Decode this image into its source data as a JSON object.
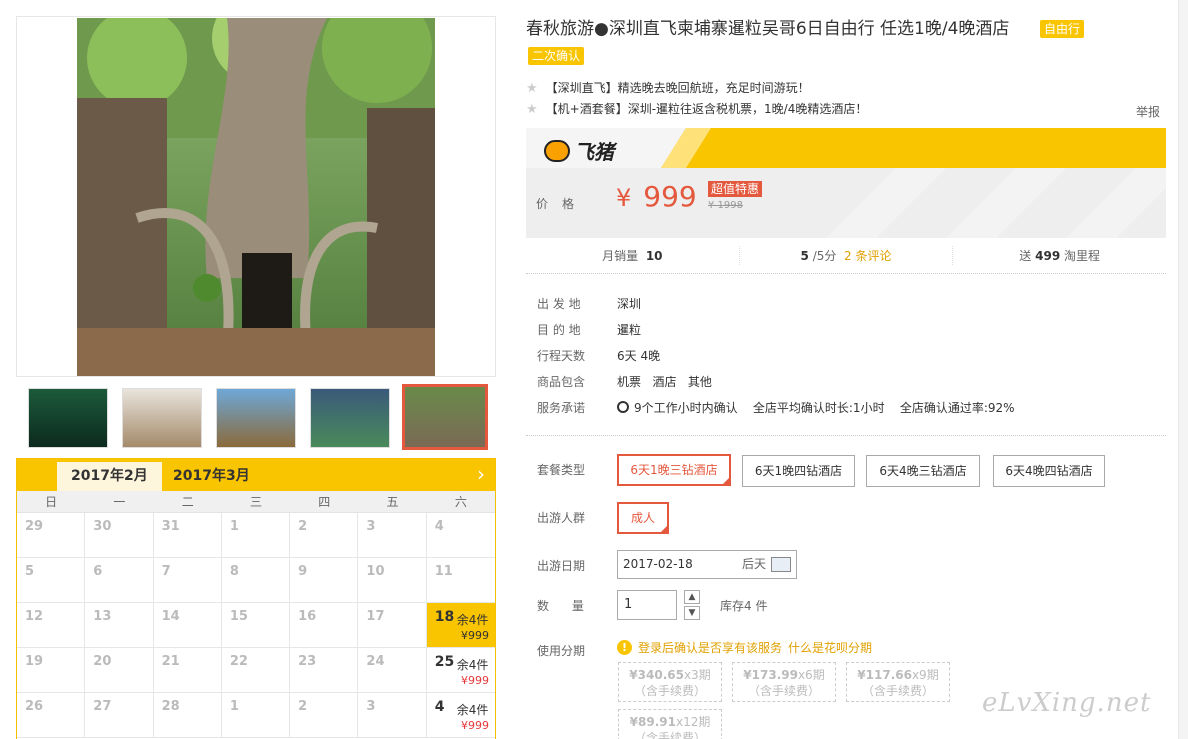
{
  "product": {
    "title": "春秋旅游●深圳直飞柬埔寨暹粒吴哥6日自由行 任选1晚/4晚酒店",
    "tags": [
      "自由行",
      "二次确认"
    ],
    "features": [
      "【深圳直飞】精选晚去晚回航班，充足时间游玩！",
      "【机+酒套餐】深圳-暹粒往返含税机票，1晚/4晚精选酒店！"
    ],
    "report_label": "举报"
  },
  "brand": {
    "name": "飞猪",
    "colors": {
      "accent": "#f9c400",
      "price": "#e4583e"
    }
  },
  "price": {
    "label": "价格",
    "currency": "¥",
    "value": "999",
    "badge": "超值特惠",
    "original": "¥ 1998"
  },
  "stats": {
    "monthly_sales_label": "月销量",
    "monthly_sales": "10",
    "rating": "5",
    "rating_suffix": "/5分",
    "reviews": "2 条评论",
    "mileage_prefix": "送",
    "mileage": "499",
    "mileage_suffix": "淘里程"
  },
  "info": [
    {
      "key": "出 发 地",
      "value": "深圳"
    },
    {
      "key": "目 的 地",
      "value": "暹粒"
    },
    {
      "key": "行程天数",
      "value": "6天 4晚"
    },
    {
      "key": "商品包含",
      "value": "机票   酒店   其他"
    },
    {
      "key": "服务承诺",
      "value": "9个工作小时内确认    全店平均确认时长:1小时    全店确认通过率:92%"
    }
  ],
  "options": {
    "package_label": "套餐类型",
    "packages": [
      "6天1晚三钻酒店",
      "6天1晚四钻酒店",
      "6天4晚三钻酒店",
      "6天4晚四钻酒店"
    ],
    "crowd_label": "出游人群",
    "crowd": "成人",
    "date_label": "出游日期",
    "date_value": "2017-02-18",
    "date_hint": "后天",
    "qty_label": "数      量",
    "qty_value": "1",
    "stock": "库存4 件",
    "installment_label": "使用分期",
    "installment_warn": "登录后确认是否享有该服务",
    "installment_link": "什么是花呗分期",
    "installments": [
      {
        "amount": "¥340.65",
        "period": "x3期",
        "note": "（含手续费）"
      },
      {
        "amount": "¥173.99",
        "period": "x6期",
        "note": "（含手续费）"
      },
      {
        "amount": "¥117.66",
        "period": "x9期",
        "note": "（含手续费）"
      },
      {
        "amount": "¥89.91",
        "period": "x12期",
        "note": "（含手续费）"
      }
    ]
  },
  "calendar": {
    "tabs": [
      "2017年2月",
      "2017年3月"
    ],
    "next_icon": "chevron-right-icon",
    "weekdays": [
      "日",
      "一",
      "二",
      "三",
      "四",
      "五",
      "六"
    ],
    "rows": [
      [
        "29",
        "30",
        "31",
        "1",
        "2",
        "3",
        "4"
      ],
      [
        "5",
        "6",
        "7",
        "8",
        "9",
        "10",
        "11"
      ],
      [
        "12",
        "13",
        "14",
        "15",
        "16",
        "17",
        "18"
      ],
      [
        "19",
        "20",
        "21",
        "22",
        "23",
        "24",
        "25"
      ],
      [
        "26",
        "27",
        "28",
        "1",
        "2",
        "3",
        "4"
      ]
    ],
    "available": [
      {
        "day": "18",
        "remain": "余4件",
        "price": "¥999"
      },
      {
        "day": "25",
        "remain": "余4件",
        "price": "¥999"
      },
      {
        "day": "4",
        "remain": "余4件",
        "price": "¥999"
      }
    ]
  },
  "watermark": "eLvXing.net"
}
